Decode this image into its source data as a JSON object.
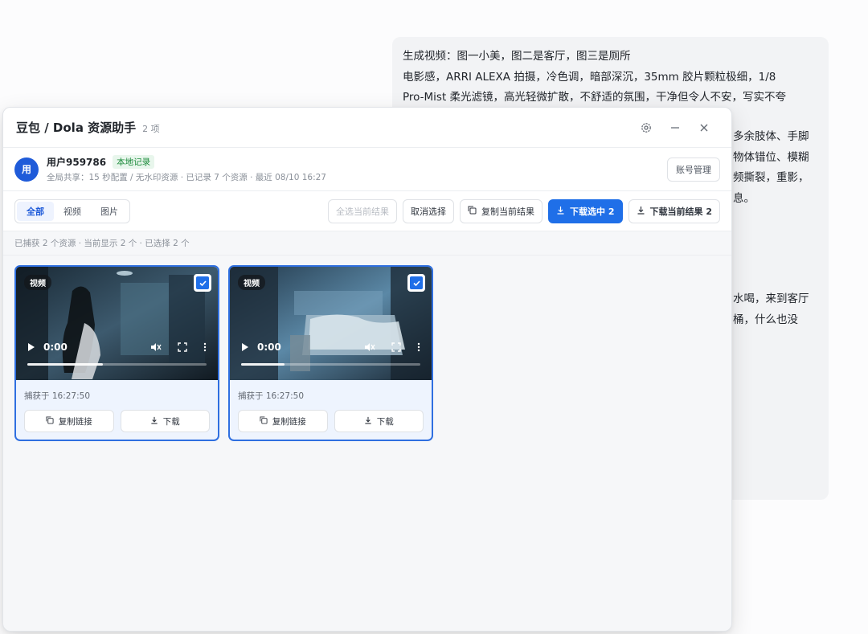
{
  "chat": {
    "lines": [
      "生成视频：图一小美，图二是客厅，图三是厕所",
      "电影感，ARRI ALEXA 拍摄，冷色调，暗部深沉，35mm 胶片颗粒极细，1/8",
      "Pro-Mist 柔光滤镜，高光轻微扩散，不舒适的氛围，干净但令人不安，写实不夸"
    ],
    "tail_lines": [
      "多余肢体、手脚",
      "物体错位、模糊",
      "频撕裂，重影，",
      "息。"
    ],
    "tail2_lines": [
      "水喝，来到客厅",
      "桶，什么也没"
    ]
  },
  "panel": {
    "title": "豆包 / Dola 资源助手",
    "count": "2 项",
    "user": {
      "avatar": "用",
      "name": "用户959786",
      "badge": "本地记录",
      "sub": "全局共享：15 秒配置 / 无水印资源 · 已记录 7 个资源 · 最近 08/10 16:27",
      "account_btn": "账号管理"
    },
    "filters": [
      "全部",
      "视频",
      "图片"
    ],
    "active_filter": "全部",
    "toolbar": {
      "select_all": "全选当前结果",
      "deselect": "取消选择",
      "copy_current": "复制当前结果",
      "download_selected": "下载选中 2",
      "download_current": "下载当前结果 2"
    },
    "status": "已捕获 2 个资源 · 当前显示 2 个 · 已选择 2 个",
    "cards": [
      {
        "tag": "视频",
        "time": "0:00",
        "captured": "捕获于 16:27:50",
        "copy_link": "复制链接",
        "download": "下载",
        "checked": true
      },
      {
        "tag": "视频",
        "time": "0:00",
        "captured": "捕获于 16:27:50",
        "copy_link": "复制链接",
        "download": "下载",
        "checked": true
      }
    ]
  },
  "colors": {
    "accent": "#1f6fe8",
    "badge_green": "#1b8a3a"
  },
  "icons": [
    "settings-icon",
    "minimize-icon",
    "close-icon",
    "copy-icon",
    "download-icon",
    "play-icon",
    "mute-icon",
    "fullscreen-icon",
    "more-icon",
    "check-icon"
  ]
}
